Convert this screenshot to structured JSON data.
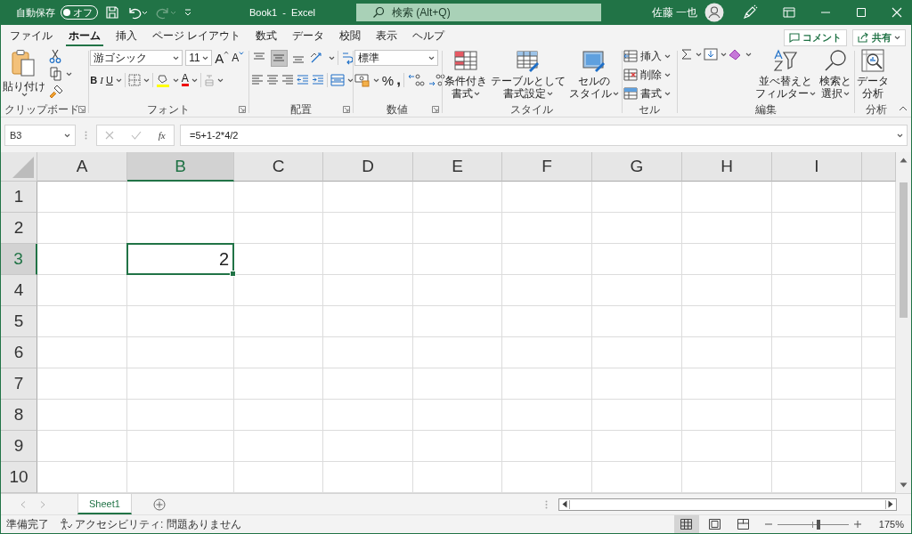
{
  "title_bar": {
    "autosave_label": "自動保存",
    "autosave_toggle": {
      "label": "オフ",
      "on": false
    },
    "document_title": "Book1  -  Excel",
    "search_placeholder": "検索 (Alt+Q)",
    "user_name": "佐藤 一也"
  },
  "menu_tabs": [
    {
      "label": "ファイル",
      "selected": false
    },
    {
      "label": "ホーム",
      "selected": true
    },
    {
      "label": "挿入",
      "selected": false
    },
    {
      "label": "ページ レイアウト",
      "selected": false
    },
    {
      "label": "数式",
      "selected": false
    },
    {
      "label": "データ",
      "selected": false
    },
    {
      "label": "校閲",
      "selected": false
    },
    {
      "label": "表示",
      "selected": false
    },
    {
      "label": "ヘルプ",
      "selected": false
    }
  ],
  "comment_button": "コメント",
  "share_button": "共有",
  "ribbon": {
    "clipboard": {
      "label": "クリップボード",
      "paste": "貼り付け"
    },
    "font": {
      "label": "フォント",
      "font_name": "游ゴシック",
      "font_size": "11",
      "grow": "A",
      "shrink": "A",
      "bold": "B",
      "italic": "I",
      "underline": "U",
      "font_color": "A"
    },
    "alignment": {
      "label": "配置",
      "vertical": [
        {
          "kind": "top",
          "selected": false
        },
        {
          "kind": "middle",
          "selected": true
        },
        {
          "kind": "bottom",
          "selected": false
        }
      ]
    },
    "number": {
      "label": "数値",
      "format": "標準",
      "percent": "%",
      "comma": ","
    },
    "styles": {
      "label": "スタイル",
      "buttons": [
        {
          "kind": "conditional",
          "lines": [
            "条件付き",
            "書式"
          ]
        },
        {
          "kind": "table",
          "lines": [
            "テーブルとして",
            "書式設定"
          ]
        },
        {
          "kind": "cell",
          "lines": [
            "セルの",
            "スタイル"
          ]
        }
      ]
    },
    "cells": {
      "label": "セル",
      "items": [
        {
          "kind": "insert",
          "label": "挿入"
        },
        {
          "kind": "delete",
          "label": "削除"
        },
        {
          "kind": "format",
          "label": "書式"
        }
      ]
    },
    "editing": {
      "label": "編集",
      "sort": [
        "並べ替えと",
        "フィルター"
      ],
      "find": [
        "検索と",
        "選択"
      ]
    },
    "analysis": {
      "label": "分析",
      "data_analysis": [
        "データ",
        "分析"
      ]
    }
  },
  "formula_bar": {
    "name_box": "B3",
    "function_label": "fx",
    "formula": "=5+1-2*4/2"
  },
  "sheet": {
    "columns": [
      {
        "label": "A",
        "selected": false
      },
      {
        "label": "B",
        "selected": true
      },
      {
        "label": "C",
        "selected": false
      },
      {
        "label": "D",
        "selected": false
      },
      {
        "label": "E",
        "selected": false
      },
      {
        "label": "F",
        "selected": false
      },
      {
        "label": "G",
        "selected": false
      },
      {
        "label": "H",
        "selected": false
      },
      {
        "label": "I",
        "selected": false
      }
    ],
    "rows": [
      {
        "label": "1",
        "selected": false
      },
      {
        "label": "2",
        "selected": false
      },
      {
        "label": "3",
        "selected": true
      },
      {
        "label": "4",
        "selected": false
      },
      {
        "label": "5",
        "selected": false
      },
      {
        "label": "6",
        "selected": false
      },
      {
        "label": "7",
        "selected": false
      },
      {
        "label": "8",
        "selected": false
      },
      {
        "label": "9",
        "selected": false
      },
      {
        "label": "10",
        "selected": false
      }
    ],
    "active_cell": {
      "value": "2"
    }
  },
  "sheet_tabs": [
    {
      "label": "Sheet1",
      "selected": true
    }
  ],
  "status_bar": {
    "ready": "準備完了",
    "accessibility": "アクセシビリティ: 問題ありません",
    "views": [
      {
        "kind": "normal",
        "selected": true
      },
      {
        "kind": "page_layout",
        "selected": false
      },
      {
        "kind": "page_break",
        "selected": false
      }
    ],
    "zoom": {
      "level": 0.58,
      "reading": "175%"
    }
  }
}
